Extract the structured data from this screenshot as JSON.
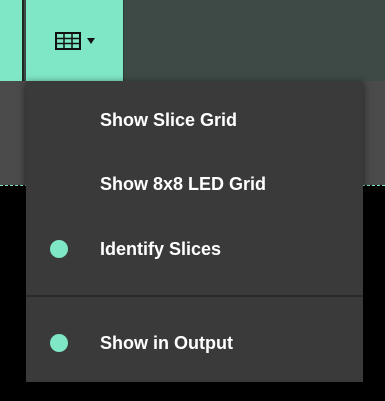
{
  "colors": {
    "accent": "#7fe7c6",
    "menu_bg": "#3a3a3a",
    "label": "#ffffff"
  },
  "toolbar": {
    "grid_button_icon": "grid-icon",
    "dropdown_icon": "chevron-down-icon"
  },
  "menu": {
    "items": [
      {
        "label": "Show Slice Grid",
        "checked": false
      },
      {
        "label": "Show 8x8 LED Grid",
        "checked": false
      },
      {
        "label": "Identify Slices",
        "checked": true
      },
      {
        "label": "Show in Output",
        "checked": true
      }
    ]
  }
}
